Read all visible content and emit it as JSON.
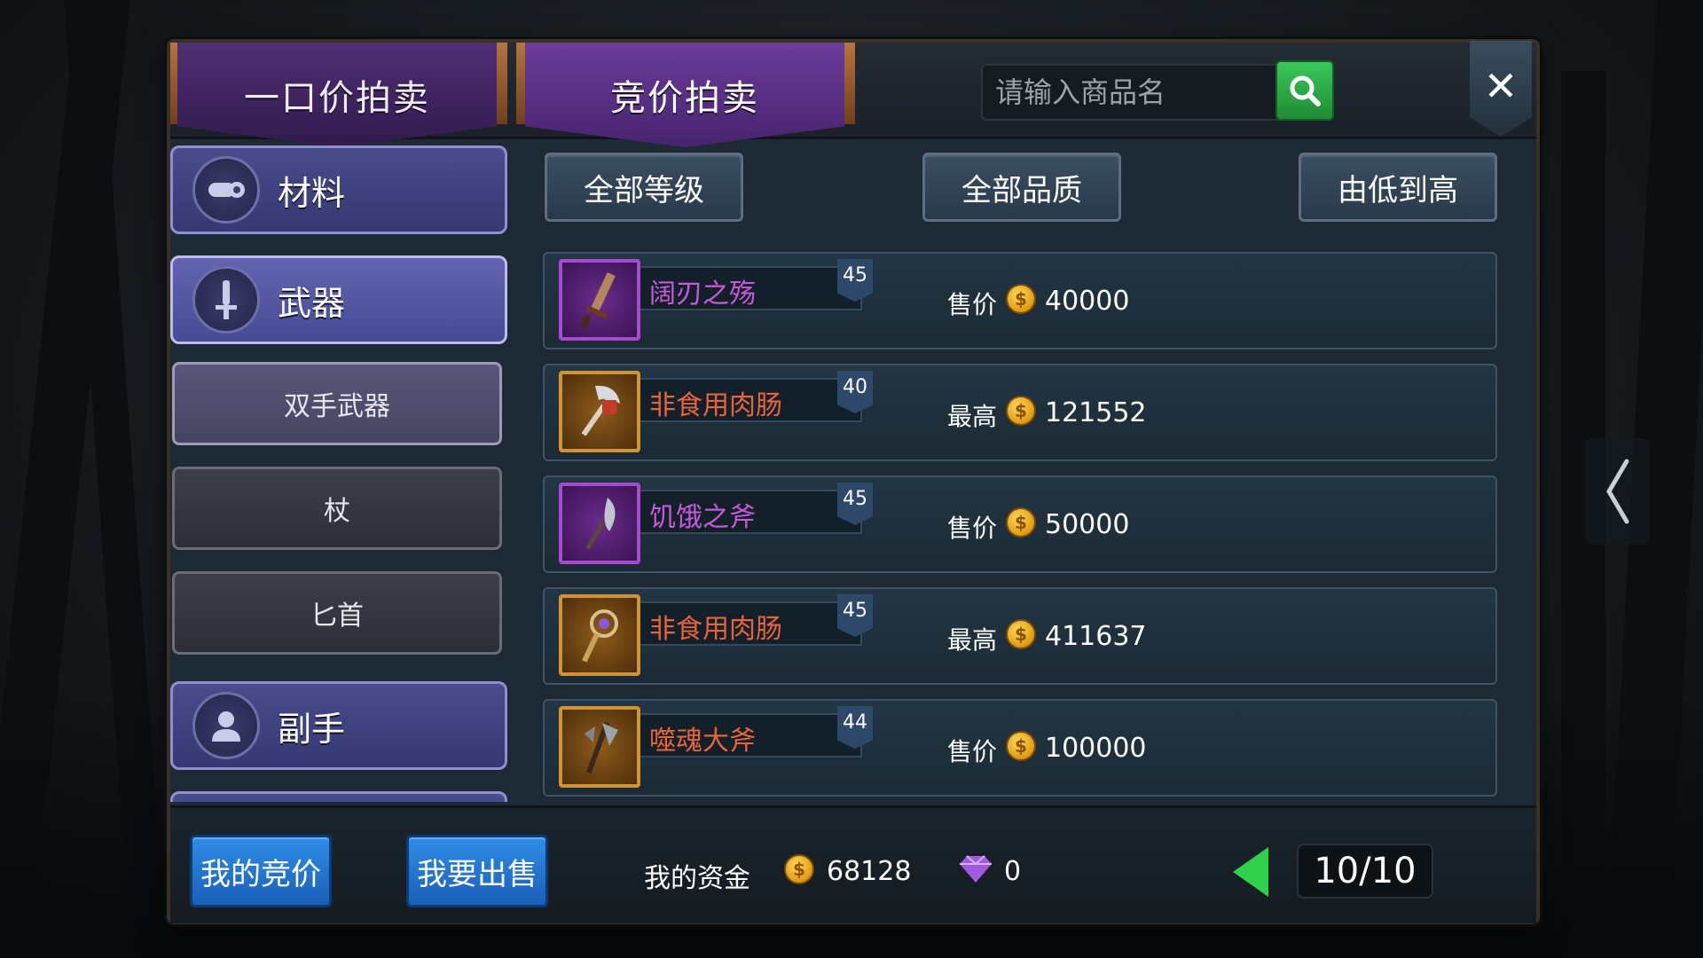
{
  "tabs": [
    {
      "label": "一口价拍卖",
      "active": false
    },
    {
      "label": "竞价拍卖",
      "active": true
    }
  ],
  "search": {
    "placeholder": "请输入商品名",
    "button_icon": "search-icon"
  },
  "close": {
    "icon": "close-icon",
    "label": "✕"
  },
  "categories": [
    {
      "label": "材料",
      "icon": "material-icon",
      "selected": false
    },
    {
      "label": "武器",
      "icon": "sword-icon",
      "selected": true
    },
    {
      "label": "副手",
      "icon": "offhand-icon",
      "selected": false
    }
  ],
  "subcategories": [
    {
      "label": "双手武器",
      "selected": true
    },
    {
      "label": "杖",
      "selected": false
    },
    {
      "label": "匕首",
      "selected": false
    }
  ],
  "filters": {
    "level": "全部等级",
    "quality": "全部品质",
    "sort": "由低到高"
  },
  "items": [
    {
      "name": "阔刃之殇",
      "level": "45",
      "price_label": "售价",
      "price": "40000",
      "quality": "purple",
      "icon": "greatsword-icon"
    },
    {
      "name": "非食用肉肠",
      "level": "40",
      "price_label": "最高",
      "price": "121552",
      "quality": "orange",
      "icon": "axe-icon"
    },
    {
      "name": "饥饿之斧",
      "level": "45",
      "price_label": "售价",
      "price": "50000",
      "quality": "purple",
      "icon": "feather-axe-icon"
    },
    {
      "name": "非食用肉肠",
      "level": "45",
      "price_label": "最高",
      "price": "411637",
      "quality": "orange",
      "icon": "staff-icon"
    },
    {
      "name": "噬魂大斧",
      "level": "44",
      "price_label": "售价",
      "price": "100000",
      "quality": "orange",
      "icon": "halberd-icon"
    }
  ],
  "coin_symbol": "$",
  "footer": {
    "my_bids": "我的竞价",
    "sell": "我要出售",
    "funds_label": "我的资金",
    "gold": "68128",
    "diamonds": "0",
    "page": "10/10"
  },
  "colors": {
    "purple_quality": "#c65ad8",
    "orange_quality": "#e8643a",
    "accent_green": "#2fd04a",
    "button_blue": "#2f8ee8"
  }
}
